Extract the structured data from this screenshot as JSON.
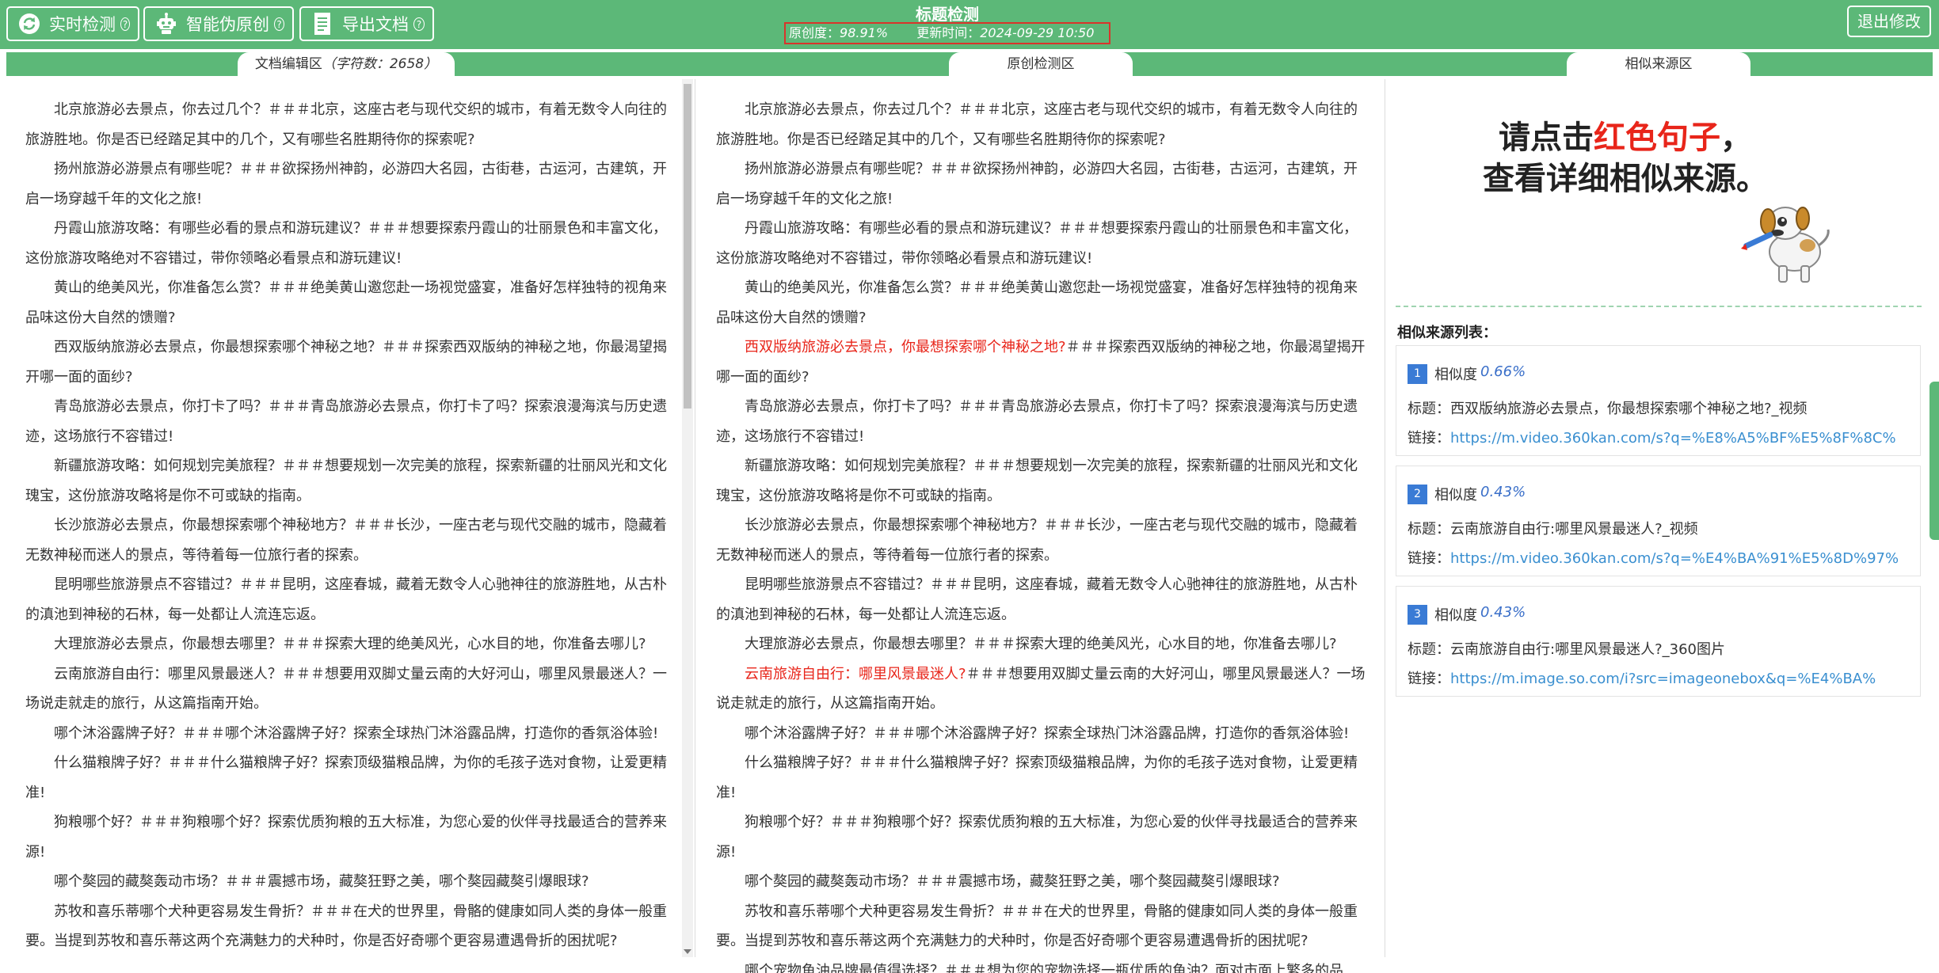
{
  "toolbar": {
    "realtime_label": "实时检测",
    "smart_label": "智能伪原创",
    "export_label": "导出文档",
    "help_glyph": "?"
  },
  "header": {
    "title": "标题检测",
    "originality_label": "原创度：",
    "originality_value": "98.91%",
    "update_label": "更新时间：",
    "update_value": "2024-09-29 10:50",
    "exit_label": "退出修改"
  },
  "columns": {
    "editor_label": "文档编辑区",
    "char_count": "（字符数：2658）",
    "check_label": "原创检测区",
    "similar_label": "相似来源区"
  },
  "editor_paragraphs": [
    "北京旅游必去景点，你去过几个？＃＃＃北京，这座古老与现代交织的城市，有着无数令人向往的旅游胜地。你是否已经踏足其中的几个，又有哪些名胜期待你的探索呢?",
    "扬州旅游必游景点有哪些呢？＃＃＃欲探扬州神韵，必游四大名园，古街巷，古运河，古建筑，开启一场穿越千年的文化之旅!",
    "丹霞山旅游攻略：有哪些必看的景点和游玩建议？＃＃＃想要探索丹霞山的壮丽景色和丰富文化，这份旅游攻略绝对不容错过，带你领略必看景点和游玩建议!",
    "黄山的绝美风光，你准备怎么赏？＃＃＃绝美黄山邀您赴一场视觉盛宴，准备好怎样独特的视角来品味这份大自然的馈赠?",
    "西双版纳旅游必去景点，你最想探索哪个神秘之地？＃＃＃探索西双版纳的神秘之地，你最渴望揭开哪一面的面纱?",
    "青岛旅游必去景点，你打卡了吗？＃＃＃青岛旅游必去景点，你打卡了吗？探索浪漫海滨与历史遗迹，这场旅行不容错过!",
    "新疆旅游攻略：如何规划完美旅程？＃＃＃想要规划一次完美的旅程，探索新疆的壮丽风光和文化瑰宝，这份旅游攻略将是你不可或缺的指南。",
    "长沙旅游必去景点，你最想探索哪个神秘地方？＃＃＃长沙，一座古老与现代交融的城市，隐藏着无数神秘而迷人的景点，等待着每一位旅行者的探索。",
    "昆明哪些旅游景点不容错过？＃＃＃昆明，这座春城，藏着无数令人心驰神往的旅游胜地，从古朴的滇池到神秘的石林，每一处都让人流连忘返。",
    "大理旅游必去景点，你最想去哪里？＃＃＃探索大理的绝美风光，心水目的地，你准备去哪儿?",
    "云南旅游自由行：哪里风景最迷人？＃＃＃想要用双脚丈量云南的大好河山，哪里风景最迷人？一场说走就走的旅行，从这篇指南开始。",
    "哪个沐浴露牌子好？＃＃＃哪个沐浴露牌子好？探索全球热门沐浴露品牌，打造你的香氛浴体验!",
    "什么猫粮牌子好？＃＃＃什么猫粮牌子好？探索顶级猫粮品牌，为你的毛孩子选对食物，让爱更精准!",
    "狗粮哪个好？＃＃＃狗粮哪个好？探索优质狗粮的五大标准，为您心爱的伙伴寻找最适合的营养来源!",
    "哪个獒园的藏獒轰动市场？＃＃＃震撼市场，藏獒狂野之美，哪个獒园藏獒引爆眼球?",
    "苏牧和喜乐蒂哪个犬种更容易发生骨折？＃＃＃在犬的世界里，骨骼的健康如同人类的身体一般重要。当提到苏牧和喜乐蒂这两个充满魅力的犬种时，你是否好奇哪个更容易遭遇骨折的困扰呢?"
  ],
  "check_paragraphs": [
    {
      "hl": "",
      "rest": "北京旅游必去景点，你去过几个？＃＃＃北京，这座古老与现代交织的城市，有着无数令人向往的旅游胜地。你是否已经踏足其中的几个，又有哪些名胜期待你的探索呢?"
    },
    {
      "hl": "",
      "rest": "扬州旅游必游景点有哪些呢？＃＃＃欲探扬州神韵，必游四大名园，古街巷，古运河，古建筑，开启一场穿越千年的文化之旅!"
    },
    {
      "hl": "",
      "rest": "丹霞山旅游攻略：有哪些必看的景点和游玩建议？＃＃＃想要探索丹霞山的壮丽景色和丰富文化，这份旅游攻略绝对不容错过，带你领略必看景点和游玩建议!"
    },
    {
      "hl": "",
      "rest": "黄山的绝美风光，你准备怎么赏？＃＃＃绝美黄山邀您赴一场视觉盛宴，准备好怎样独特的视角来品味这份大自然的馈赠?"
    },
    {
      "hl": "西双版纳旅游必去景点，你最想探索哪个神秘之地?",
      "rest": "＃＃＃探索西双版纳的神秘之地，你最渴望揭开哪一面的面纱?"
    },
    {
      "hl": "",
      "rest": "青岛旅游必去景点，你打卡了吗？＃＃＃青岛旅游必去景点，你打卡了吗？探索浪漫海滨与历史遗迹，这场旅行不容错过!"
    },
    {
      "hl": "",
      "rest": "新疆旅游攻略：如何规划完美旅程？＃＃＃想要规划一次完美的旅程，探索新疆的壮丽风光和文化瑰宝，这份旅游攻略将是你不可或缺的指南。"
    },
    {
      "hl": "",
      "rest": "长沙旅游必去景点，你最想探索哪个神秘地方？＃＃＃长沙，一座古老与现代交融的城市，隐藏着无数神秘而迷人的景点，等待着每一位旅行者的探索。"
    },
    {
      "hl": "",
      "rest": "昆明哪些旅游景点不容错过？＃＃＃昆明，这座春城，藏着无数令人心驰神往的旅游胜地，从古朴的滇池到神秘的石林，每一处都让人流连忘返。"
    },
    {
      "hl": "",
      "rest": "大理旅游必去景点，你最想去哪里？＃＃＃探索大理的绝美风光，心水目的地，你准备去哪儿?"
    },
    {
      "hl": "云南旅游自由行：哪里风景最迷人?",
      "rest": "＃＃＃想要用双脚丈量云南的大好河山，哪里风景最迷人？一场说走就走的旅行，从这篇指南开始。"
    },
    {
      "hl": "",
      "rest": "哪个沐浴露牌子好？＃＃＃哪个沐浴露牌子好？探索全球热门沐浴露品牌，打造你的香氛浴体验!"
    },
    {
      "hl": "",
      "rest": "什么猫粮牌子好？＃＃＃什么猫粮牌子好？探索顶级猫粮品牌，为你的毛孩子选对食物，让爱更精准!"
    },
    {
      "hl": "",
      "rest": "狗粮哪个好？＃＃＃狗粮哪个好？探索优质狗粮的五大标准，为您心爱的伙伴寻找最适合的营养来源!"
    },
    {
      "hl": "",
      "rest": "哪个獒园的藏獒轰动市场？＃＃＃震撼市场，藏獒狂野之美，哪个獒园藏獒引爆眼球?"
    },
    {
      "hl": "",
      "rest": "苏牧和喜乐蒂哪个犬种更容易发生骨折？＃＃＃在犬的世界里，骨骼的健康如同人类的身体一般重要。当提到苏牧和喜乐蒂这两个充满魅力的犬种时，你是否好奇哪个更容易遭遇骨折的困扰呢?"
    },
    {
      "hl": "",
      "rest": "哪个宠物鱼油品牌最值得选择？＃＃＃想为您的宠物选择一瓶优质的鱼油？面对市面上繁多的品牌，哪个才是真正的宠粮必备?"
    }
  ],
  "similar": {
    "prompt_line1_pre": "请点击",
    "prompt_line1_red": "红色句子",
    "prompt_line1_post": "，",
    "prompt_line2": "查看详细相似来源。",
    "list_label": "相似来源列表：",
    "sim_label": "相似度",
    "title_label": "标题：",
    "link_label": "链接：",
    "items": [
      {
        "num": "1",
        "similarity": "0.66%",
        "title": "西双版纳旅游必去景点，你最想探索哪个神秘之地?_视频",
        "link": "https://m.video.360kan.com/s?q=%E8%A5%BF%E5%8F%8C%"
      },
      {
        "num": "2",
        "similarity": "0.43%",
        "title": "云南旅游自由行:哪里风景最迷人?_视频",
        "link": "https://m.video.360kan.com/s?q=%E4%BA%91%E5%8D%97%"
      },
      {
        "num": "3",
        "similarity": "0.43%",
        "title": "云南旅游自由行:哪里风景最迷人?_360图片",
        "link": "https://m.image.so.com/i?src=imageonebox&q=%E4%BA%"
      }
    ]
  },
  "colors": {
    "brand_green": "#5cb878",
    "highlight_red": "#e8251a",
    "link_blue": "#3a8fd0",
    "badge_blue": "#3a7bd5"
  }
}
